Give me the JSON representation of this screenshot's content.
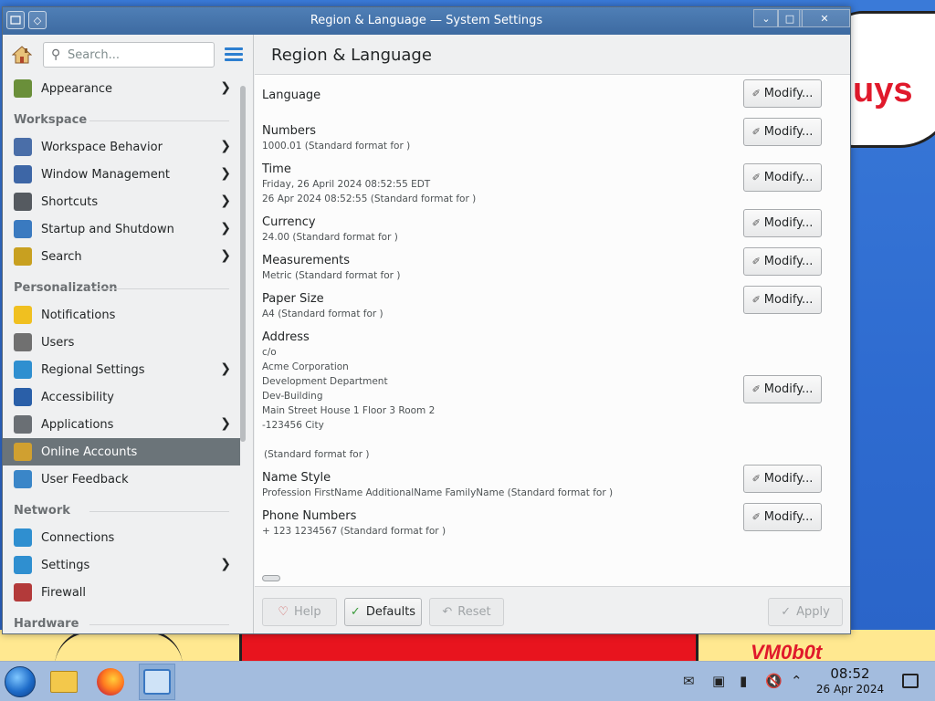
{
  "window": {
    "title": "Region & Language — System Settings",
    "minimize_glyph": "⌄",
    "maximize_glyph": "□",
    "close_glyph": "✕",
    "menu_glyph": "◇"
  },
  "sidebar": {
    "search_placeholder": "Search...",
    "items": [
      {
        "label": "Appearance",
        "icon": "appearance-icon",
        "chevron": true
      },
      {
        "header": "Workspace"
      },
      {
        "label": "Workspace Behavior",
        "icon": "workspace-behavior-icon",
        "chevron": true
      },
      {
        "label": "Window Management",
        "icon": "window-management-icon",
        "chevron": true
      },
      {
        "label": "Shortcuts",
        "icon": "shortcuts-icon",
        "chevron": true
      },
      {
        "label": "Startup and Shutdown",
        "icon": "startup-icon",
        "chevron": true
      },
      {
        "label": "Search",
        "icon": "search-category-icon",
        "chevron": true
      },
      {
        "header": "Personalization"
      },
      {
        "label": "Notifications",
        "icon": "bell-icon",
        "chevron": false
      },
      {
        "label": "Users",
        "icon": "users-icon",
        "chevron": false
      },
      {
        "label": "Regional Settings",
        "icon": "globe-icon",
        "chevron": true
      },
      {
        "label": "Accessibility",
        "icon": "accessibility-icon",
        "chevron": false
      },
      {
        "label": "Applications",
        "icon": "applications-icon",
        "chevron": true
      },
      {
        "label": "Online Accounts",
        "icon": "online-accounts-icon",
        "chevron": false,
        "selected": true
      },
      {
        "label": "User Feedback",
        "icon": "feedback-icon",
        "chevron": false
      },
      {
        "header": "Network"
      },
      {
        "label": "Connections",
        "icon": "connections-icon",
        "chevron": false
      },
      {
        "label": "Settings",
        "icon": "network-settings-icon",
        "chevron": true
      },
      {
        "label": "Firewall",
        "icon": "firewall-icon",
        "chevron": false
      },
      {
        "header": "Hardware"
      }
    ]
  },
  "main": {
    "title": "Region & Language",
    "modify_label": "Modify...",
    "rows": {
      "language": {
        "label": "Language"
      },
      "numbers": {
        "label": "Numbers",
        "sub": "1000.01 (Standard format for )"
      },
      "time": {
        "label": "Time",
        "sub1": "Friday, 26 April 2024 08:52:55 EDT",
        "sub2": "26 Apr 2024 08:52:55 (Standard format for )"
      },
      "currency": {
        "label": "Currency",
        "sub": "24.00 (Standard format for )"
      },
      "measurements": {
        "label": "Measurements",
        "sub": "Metric (Standard format for )"
      },
      "paper": {
        "label": "Paper Size",
        "sub": "A4 (Standard format for )"
      },
      "address": {
        "label": "Address",
        "lines": [
          "c/o",
          "Acme Corporation",
          "Development Department",
          "Dev-Building",
          "Main Street House 1 Floor 3 Room 2",
          "-123456 City"
        ],
        "sub": "(Standard format for )"
      },
      "name_style": {
        "label": "Name Style",
        "sub": "Profession FirstName AdditionalName FamilyName (Standard format for )"
      },
      "phone": {
        "label": "Phone Numbers",
        "sub": "+ 123 1234567 (Standard format for )"
      }
    },
    "buttons": {
      "help": "Help",
      "defaults": "Defaults",
      "reset": "Reset",
      "apply": "Apply"
    }
  },
  "desktop": {
    "cloud_text": "uys",
    "corner_text": "VM0b0t"
  },
  "taskbar": {
    "time": "08:52",
    "date": "26 Apr 2024"
  }
}
